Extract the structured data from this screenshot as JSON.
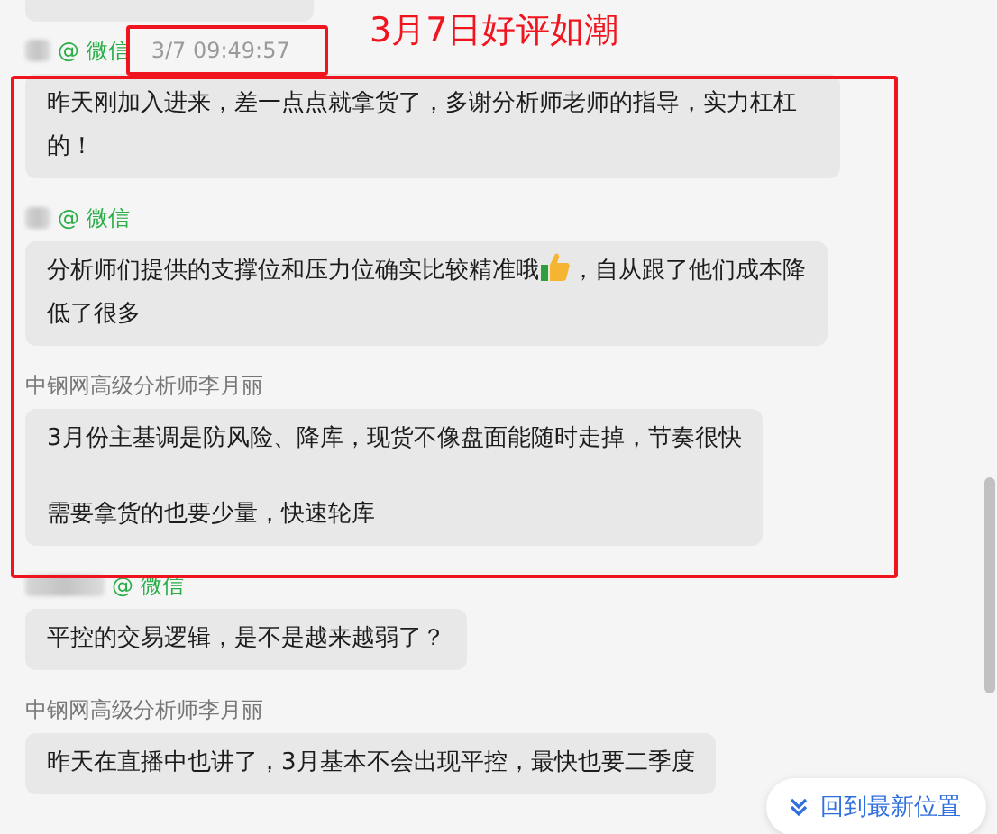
{
  "annotation": {
    "title": "3月7日好评如潮"
  },
  "messages": [
    {
      "kind": "user",
      "source": "@ 微信",
      "time": "3/7 09:49:57",
      "paragraphs": [
        [
          "昨天刚加入进来，差一点点就拿货了，多谢分析师老师的指导，实力杠杠的！"
        ]
      ]
    },
    {
      "kind": "user",
      "source": "@ 微信",
      "paragraphs": [
        [
          "分析师们提供的支撑位和压力位确实比较精准哦",
          "，自从跟了他们成本降",
          "低了很多"
        ]
      ]
    },
    {
      "kind": "analyst",
      "sender": "中钢网高级分析师李月丽",
      "paragraphs": [
        [
          "3月份主基调是防风险、降库，现货不像盘面能随时走掉，节奏很快"
        ],
        [
          "需要拿货的也要少量，快速轮库"
        ]
      ]
    },
    {
      "kind": "user",
      "source": "@ 微信",
      "paragraphs": [
        [
          "平控的交易逻辑，是不是越来越弱了？"
        ]
      ]
    },
    {
      "kind": "analyst",
      "sender": "中钢网高级分析师李月丽",
      "paragraphs": [
        [
          "昨天在直播中也讲了，3月基本不会出现平控，最快也要二季度"
        ]
      ]
    }
  ],
  "jump_button": {
    "label": "回到最新位置"
  }
}
